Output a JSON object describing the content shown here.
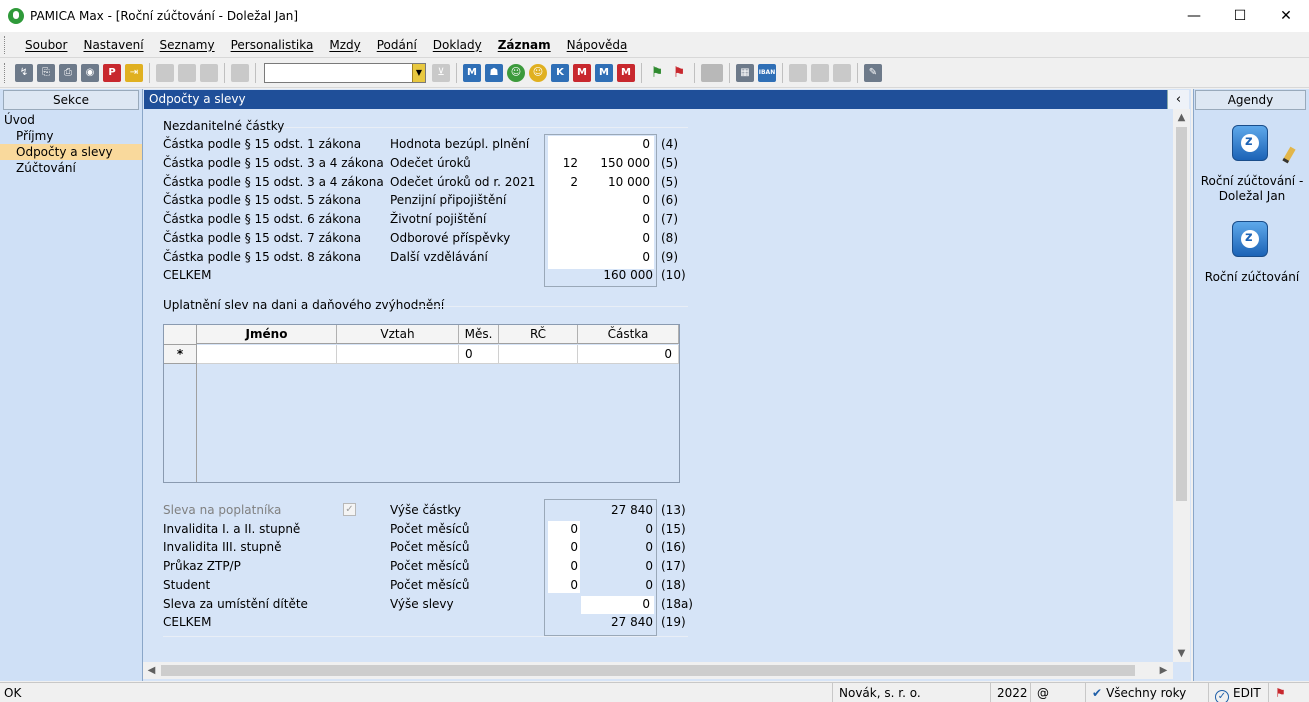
{
  "window": {
    "title": "PAMICA Max - [Roční zúčtování - Doležal Jan]",
    "minimize": "—",
    "maximize": "☐",
    "close": "✕"
  },
  "menu": [
    "Soubor",
    "Nastavení",
    "Seznamy",
    "Personalistika",
    "Mzdy",
    "Podání",
    "Doklady",
    "Záznam",
    "Nápověda"
  ],
  "toolbar": {
    "combo_value": "",
    "icons": [
      "open-icon",
      "copy-icon",
      "print-icon",
      "preview-icon",
      "pdf-icon",
      "export-icon",
      "new-icon",
      "save-icon",
      "save-all-icon",
      "duplicate-icon",
      "filter-icon",
      "m-icon",
      "person-icon",
      "green-person-icon",
      "yellow-person-icon",
      "km-icon",
      "mail-icon",
      "m2-icon",
      "red-m-icon",
      "green-flag-icon",
      "red-flag-icon",
      "folder-icon",
      "calculator-icon",
      "iban-icon",
      "note-icon",
      "list-icon",
      "list2-icon",
      "tools-icon"
    ],
    "iban_label": "IBAN"
  },
  "left_panel": {
    "header": "Sekce",
    "root": "Úvod",
    "items": [
      "Příjmy",
      "Odpočty a slevy",
      "Zúčtování"
    ],
    "selected_index": 1
  },
  "main": {
    "header": "Odpočty a slevy",
    "close_button": "‹",
    "section1_title": "Nezdanitelné částky",
    "left_labels": [
      "Částka podle § 15 odst. 1 zákona",
      "Částka podle § 15 odst. 3 a 4 zákona",
      "Částka podle § 15 odst. 3 a 4 zákona",
      "Částka podle § 15 odst. 5 zákona",
      "Částka podle § 15 odst. 6 zákona",
      "Částka podle § 15 odst. 7 zákona",
      "Částka podle § 15 odst. 8 zákona",
      "CELKEM"
    ],
    "deductions": [
      {
        "label": "Hodnota bezúpl. plnění",
        "count": "",
        "value": "0",
        "code": "(4)"
      },
      {
        "label": "Odečet úroků",
        "count": "12",
        "value": "150 000",
        "code": "(5)"
      },
      {
        "label": "Odečet úroků od r. 2021",
        "count": "2",
        "value": "10 000",
        "code": "(5)"
      },
      {
        "label": "Penzijní připojištění",
        "count": "",
        "value": "0",
        "code": "(6)"
      },
      {
        "label": "Životní pojištění",
        "count": "",
        "value": "0",
        "code": "(7)"
      },
      {
        "label": "Odborové příspěvky",
        "count": "",
        "value": "0",
        "code": "(8)"
      },
      {
        "label": "Další vzdělávání",
        "count": "",
        "value": "0",
        "code": "(9)"
      }
    ],
    "deductions_total": {
      "value": "160 000",
      "code": "(10)"
    },
    "section2_title": "Uplatnění slev na dani a daňového zvýhodnění",
    "grid": {
      "columns": [
        "Jméno",
        "Vztah",
        "Měs.",
        "RČ",
        "Částka"
      ],
      "new_row_marker": "*",
      "new_row": {
        "jmeno": "",
        "vztah": "",
        "mes": "0",
        "rc": "",
        "castka": "0"
      }
    },
    "discount_labels": [
      "Sleva na poplatníka",
      "Invalidita I. a II. stupně",
      "Invalidita III. stupně",
      "Průkaz ZTP/P",
      "Student",
      "Sleva za umístění dítěte",
      "CELKEM"
    ],
    "taxpayer_checkbox": "✓",
    "discounts": [
      {
        "label": "Výše částky",
        "count": "",
        "value": "27 840",
        "code": "(13)"
      },
      {
        "label": "Počet měsíců",
        "count": "0",
        "value": "0",
        "code": "(15)"
      },
      {
        "label": "Počet měsíců",
        "count": "0",
        "value": "0",
        "code": "(16)"
      },
      {
        "label": "Počet měsíců",
        "count": "0",
        "value": "0",
        "code": "(17)"
      },
      {
        "label": "Počet měsíců",
        "count": "0",
        "value": "0",
        "code": "(18)"
      },
      {
        "label": "Výše slevy",
        "count": "",
        "value": "0",
        "code": "(18a)"
      }
    ],
    "discounts_total": {
      "value": "27 840",
      "code": "(19)"
    }
  },
  "right_panel": {
    "header": "Agendy",
    "items": [
      "Roční zúčtování - Doležal Jan",
      "Roční zúčtování"
    ]
  },
  "status": {
    "state": "OK",
    "company": "Novák, s. r. o.",
    "year": "2022",
    "at": "@",
    "all_years": "Všechny roky",
    "mode": "EDIT"
  }
}
